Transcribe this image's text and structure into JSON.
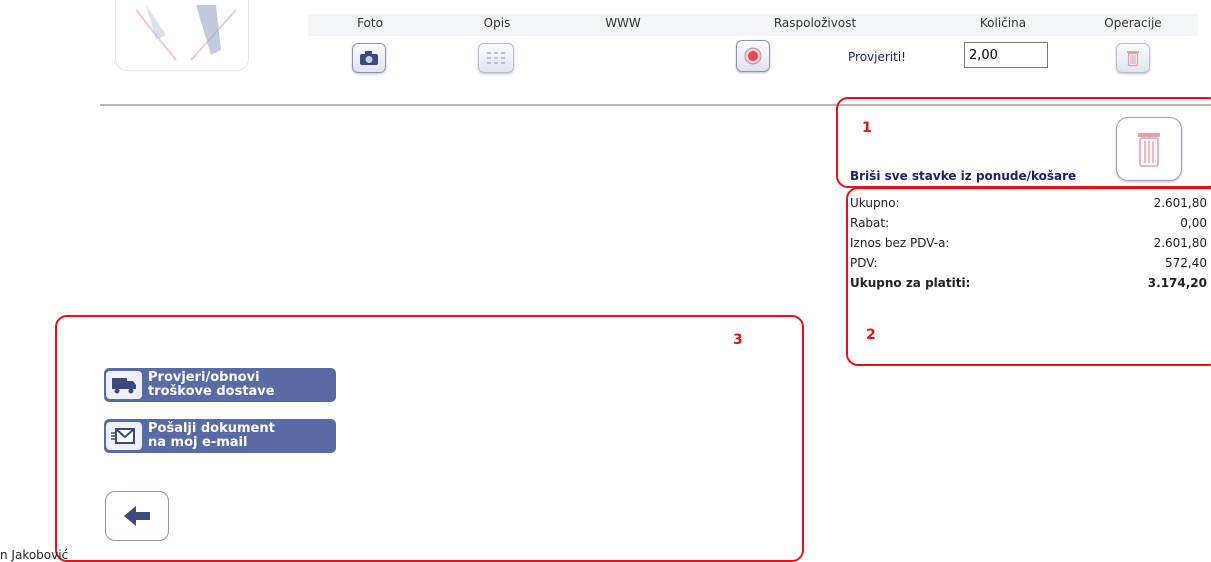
{
  "columns": {
    "foto": "Foto",
    "opis": "Opis",
    "www": "WWW",
    "raspolozivost": "Raspoloživost",
    "kolicina": "Količina",
    "operacije": "Operacije"
  },
  "item": {
    "check_label": "Provjeriti!",
    "quantity": "2,00"
  },
  "annotations": {
    "one": "1",
    "two": "2",
    "three": "3"
  },
  "delete_all_label": "Briši sve stavke iz ponude/košare",
  "totals": {
    "rows": [
      {
        "label": "Ukupno:",
        "value": "2.601,80"
      },
      {
        "label": "Rabat:",
        "value": "0,00"
      },
      {
        "label": "Iznos bez PDV-a:",
        "value": "2.601,80"
      },
      {
        "label": "PDV:",
        "value": "572,40"
      }
    ],
    "grand_label": "Ukupno za platiti:",
    "grand_value": "3.174,20"
  },
  "actions": {
    "shipping_line1": "Provjeri/obnovi",
    "shipping_line2": "troškove dostave",
    "email_line1": "Pošalji dokument",
    "email_line2": "na moj e-mail"
  },
  "footer": {
    "author_partial": "n Jakobović"
  },
  "colors": {
    "annotation_red": "#e0121b",
    "button_blue": "#5a6aa5",
    "delete_text": "#1b1f6e"
  },
  "icons": [
    "camera-icon",
    "grid-icon",
    "status-light-icon",
    "trash-icon",
    "truck-icon",
    "email-icon",
    "back-arrow-icon"
  ]
}
